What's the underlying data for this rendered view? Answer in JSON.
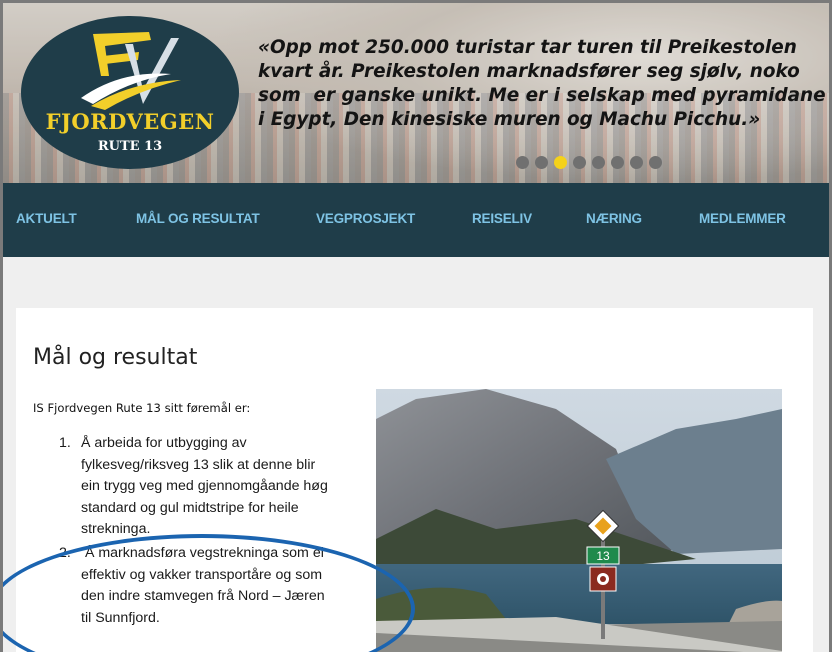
{
  "logo": {
    "name": "FJORDVEGEN",
    "sub": "RUTE 13"
  },
  "hero": {
    "quote_lines": [
      "«Opp mot 250.000 turistar tar turen til Preikestolen",
      "kvart år. Preikestolen marknadsfører seg sjølv, noko",
      "som  er ganske unikt. Me er i selskap med pyramidane",
      "i Egypt, Den kinesiske muren og Machu Picchu.»"
    ],
    "slides": 8,
    "active_slide": 3,
    "colors": {
      "dot": "#707070",
      "dot_active": "#f5d21a"
    }
  },
  "nav": {
    "items": [
      "AKTUELT",
      "MÅL OG RESULTAT",
      "VEGPROSJEKT",
      "REISELIV",
      "NÆRING",
      "MEDLEMMER"
    ],
    "colors": {
      "background": "#1f3d49",
      "text": "#7ec3e4"
    }
  },
  "content": {
    "title": "Mål og resultat",
    "intro": "IS Fjordvegen Rute 13 sitt føremål er:",
    "list": [
      {
        "num": "1.",
        "lines": [
          "Å arbeida for utbygging av",
          "fylkesveg/riksveg 13 slik at denne blir",
          "ein trygg veg med gjennomgåande høg",
          "standard og gul midtstripe for heile",
          "strekninga."
        ]
      },
      {
        "num": "2.",
        "lines": [
          " Å marknadsføra vegstrekninga som ei",
          "effektiv og vakker transportåre og som",
          "den indre stamvegen frå Nord – Jæren",
          "til Sunnfjord."
        ]
      }
    ],
    "photo_sign_number": "13"
  },
  "annotation": {
    "color": "#1b64b0"
  }
}
